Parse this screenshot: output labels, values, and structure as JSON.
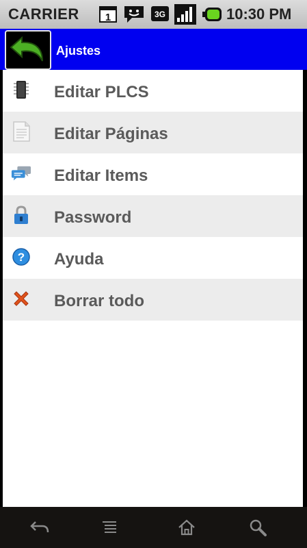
{
  "status_bar": {
    "carrier": "CARRIER",
    "notification_count": "1",
    "network_type": "3G",
    "time": "10:30 PM"
  },
  "title_bar": {
    "title": "Ajustes",
    "back_icon": "back-arrow-icon"
  },
  "menu": {
    "items": [
      {
        "label": "Editar PLCS",
        "icon": "chip-icon"
      },
      {
        "label": "Editar Páginas",
        "icon": "page-icon"
      },
      {
        "label": "Editar Items",
        "icon": "chat-bubbles-icon"
      },
      {
        "label": "Password",
        "icon": "lock-icon"
      },
      {
        "label": "Ayuda",
        "icon": "help-icon"
      },
      {
        "label": "Borrar todo",
        "icon": "delete-x-icon"
      }
    ]
  },
  "nav_bar": {
    "buttons": [
      "back-icon",
      "menu-icon",
      "home-icon",
      "search-icon"
    ]
  },
  "colors": {
    "title_bar": "#0000f0",
    "back_arrow": "#4caf24",
    "row_alt": "#ececec",
    "label": "#5a5a5a"
  }
}
